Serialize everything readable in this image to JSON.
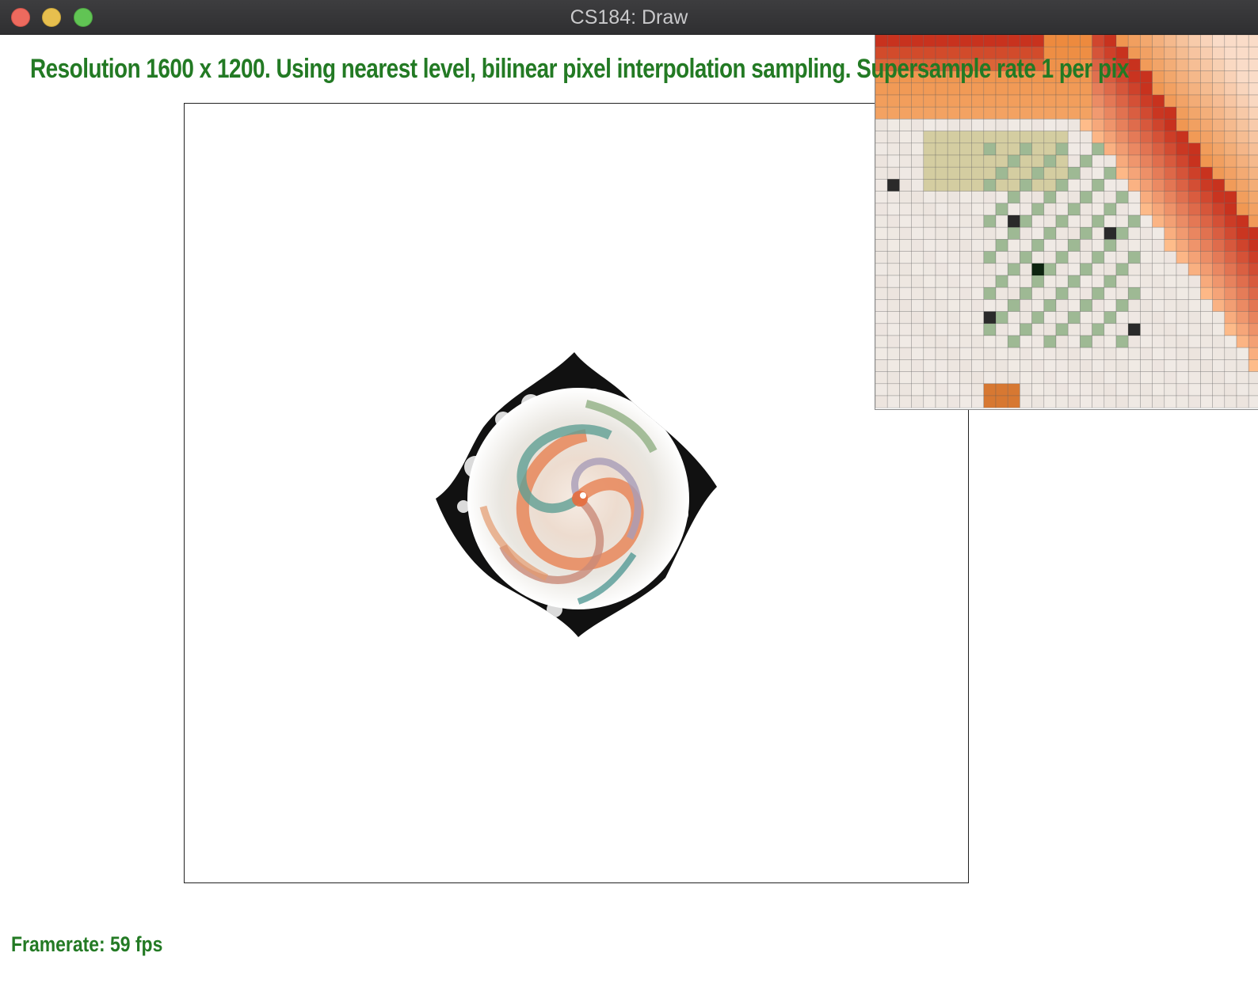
{
  "window": {
    "title": "CS184: Draw"
  },
  "status": {
    "text": "Resolution 1600 x 1200. Using nearest level, bilinear pixel interpolation sampling. Supersample rate 1 per pix"
  },
  "footer": {
    "framerate": "Framerate: 59 fps"
  },
  "colors": {
    "status_text": "#237a24",
    "titlebar": "#2f2f31",
    "close": "#ed6a5e",
    "minimize": "#e7bf4e",
    "zoom": "#61c454"
  }
}
